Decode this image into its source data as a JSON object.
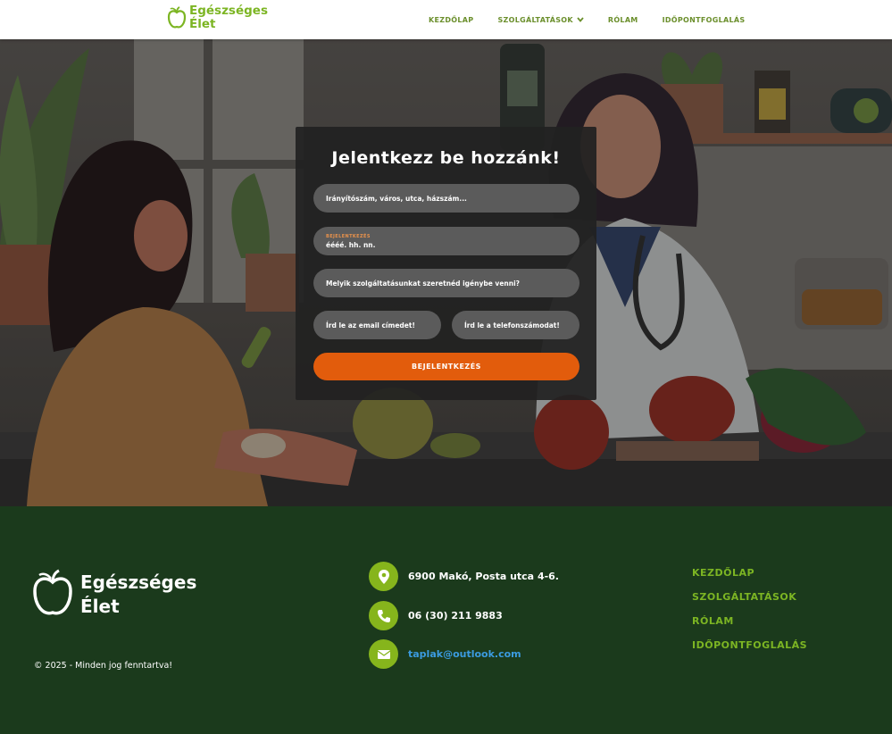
{
  "brand": {
    "name_line1": "Egészséges",
    "name_line2": "Élet"
  },
  "nav": {
    "items": [
      {
        "label": "KEZDŐLAP"
      },
      {
        "label": "SZOLGÁLTATÁSOK",
        "has_dropdown": true
      },
      {
        "label": "RÓLAM"
      },
      {
        "label": "IDŐPONTFOGLALÁS"
      }
    ]
  },
  "form": {
    "title": "Jelentkezz be hozzánk!",
    "address_placeholder": "Irányítószám, város, utca, házszám...",
    "date_label": "BEJELENTKEZÉS",
    "date_placeholder": "éééé. hh. nn.",
    "service_placeholder": "Melyik szolgáltatásunkat szeretnéd igénybe venni?",
    "email_placeholder": "Írd le az email címedet!",
    "phone_placeholder": "Írd le a telefonszámodat!",
    "submit_label": "BEJELENTKEZÉS"
  },
  "footer": {
    "copyright": "© 2025 - Minden jog fenntartva!",
    "address": "6900 Makó, Posta utca 4-6.",
    "phone": "06 (30) 211 9883",
    "email": "taplak@outlook.com",
    "nav": [
      "KEZDŐLAP",
      "SZOLGÁLTATÁSOK",
      "RÓLAM",
      "IDŐPONTFOGLALÁS"
    ]
  },
  "colors": {
    "brand_green": "#7cb523",
    "footer_bg": "#1b3a1c",
    "cta_orange": "#e25c0c",
    "link_blue": "#3b9be0"
  },
  "icons": [
    "apple-logo-icon",
    "chevron-down-icon",
    "location-pin-icon",
    "phone-icon",
    "envelope-icon"
  ]
}
